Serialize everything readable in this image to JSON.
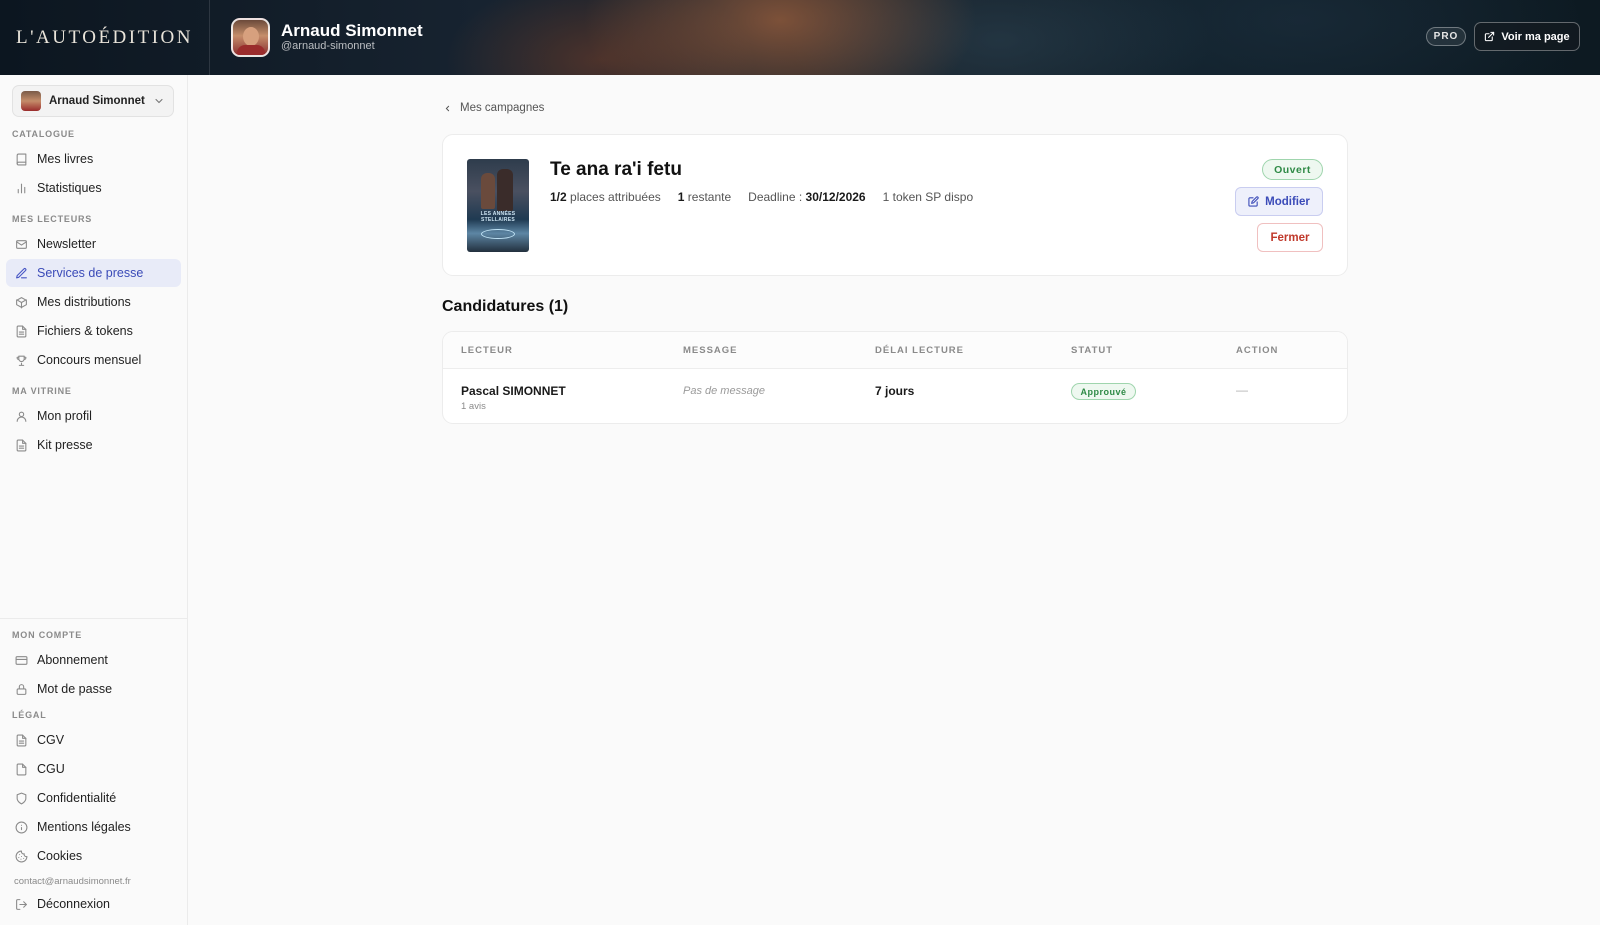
{
  "header": {
    "brand": "L'AUTOÉDITION",
    "user_name": "Arnaud Simonnet",
    "user_handle": "@arnaud-simonnet",
    "plan_badge": "PRO",
    "view_page_label": "Voir ma page"
  },
  "sidebar": {
    "account_name": "Arnaud Simonnet",
    "sections": {
      "catalogue": "CATALOGUE",
      "readers": "MES LECTEURS",
      "showcase": "MA VITRINE",
      "account": "MON COMPTE",
      "legal": "LÉGAL"
    },
    "items": {
      "books": "Mes livres",
      "stats": "Statistiques",
      "newsletter": "Newsletter",
      "press": "Services de presse",
      "distributions": "Mes distributions",
      "files": "Fichiers & tokens",
      "contest": "Concours mensuel",
      "profile": "Mon profil",
      "press_kit": "Kit presse",
      "subscription": "Abonnement",
      "password": "Mot de passe",
      "cgv": "CGV",
      "cgu": "CGU",
      "privacy": "Confidentialité",
      "legal_notice": "Mentions légales",
      "cookies": "Cookies",
      "logout": "Déconnexion"
    },
    "contact_email": "contact@arnaudsimonnet.fr"
  },
  "main": {
    "back_label": "Mes campagnes",
    "campaign": {
      "title": "Te ana ra'i fetu",
      "places_count": "1/2",
      "places_label": "places attribuées",
      "remaining_count": "1",
      "remaining_label": "restante",
      "deadline_label": "Deadline :",
      "deadline_value": "30/12/2026",
      "tokens": "1 token SP dispo",
      "status": "Ouvert",
      "edit_label": "Modifier",
      "close_label": "Fermer",
      "cover_text": "LES ANNÉES STELLAIRES"
    },
    "applications": {
      "heading": "Candidatures (1)",
      "columns": [
        "LECTEUR",
        "MESSAGE",
        "DÉLAI LECTURE",
        "STATUT",
        "ACTION"
      ],
      "rows": [
        {
          "reader": "Pascal SIMONNET",
          "reviews": "1 avis",
          "message": "Pas de message",
          "delay": "7 jours",
          "status": "Approuvé",
          "action": "—"
        }
      ]
    }
  },
  "colors": {
    "accent": "#3b4bb8",
    "success": "#2f8a46",
    "danger": "#c0392b"
  }
}
